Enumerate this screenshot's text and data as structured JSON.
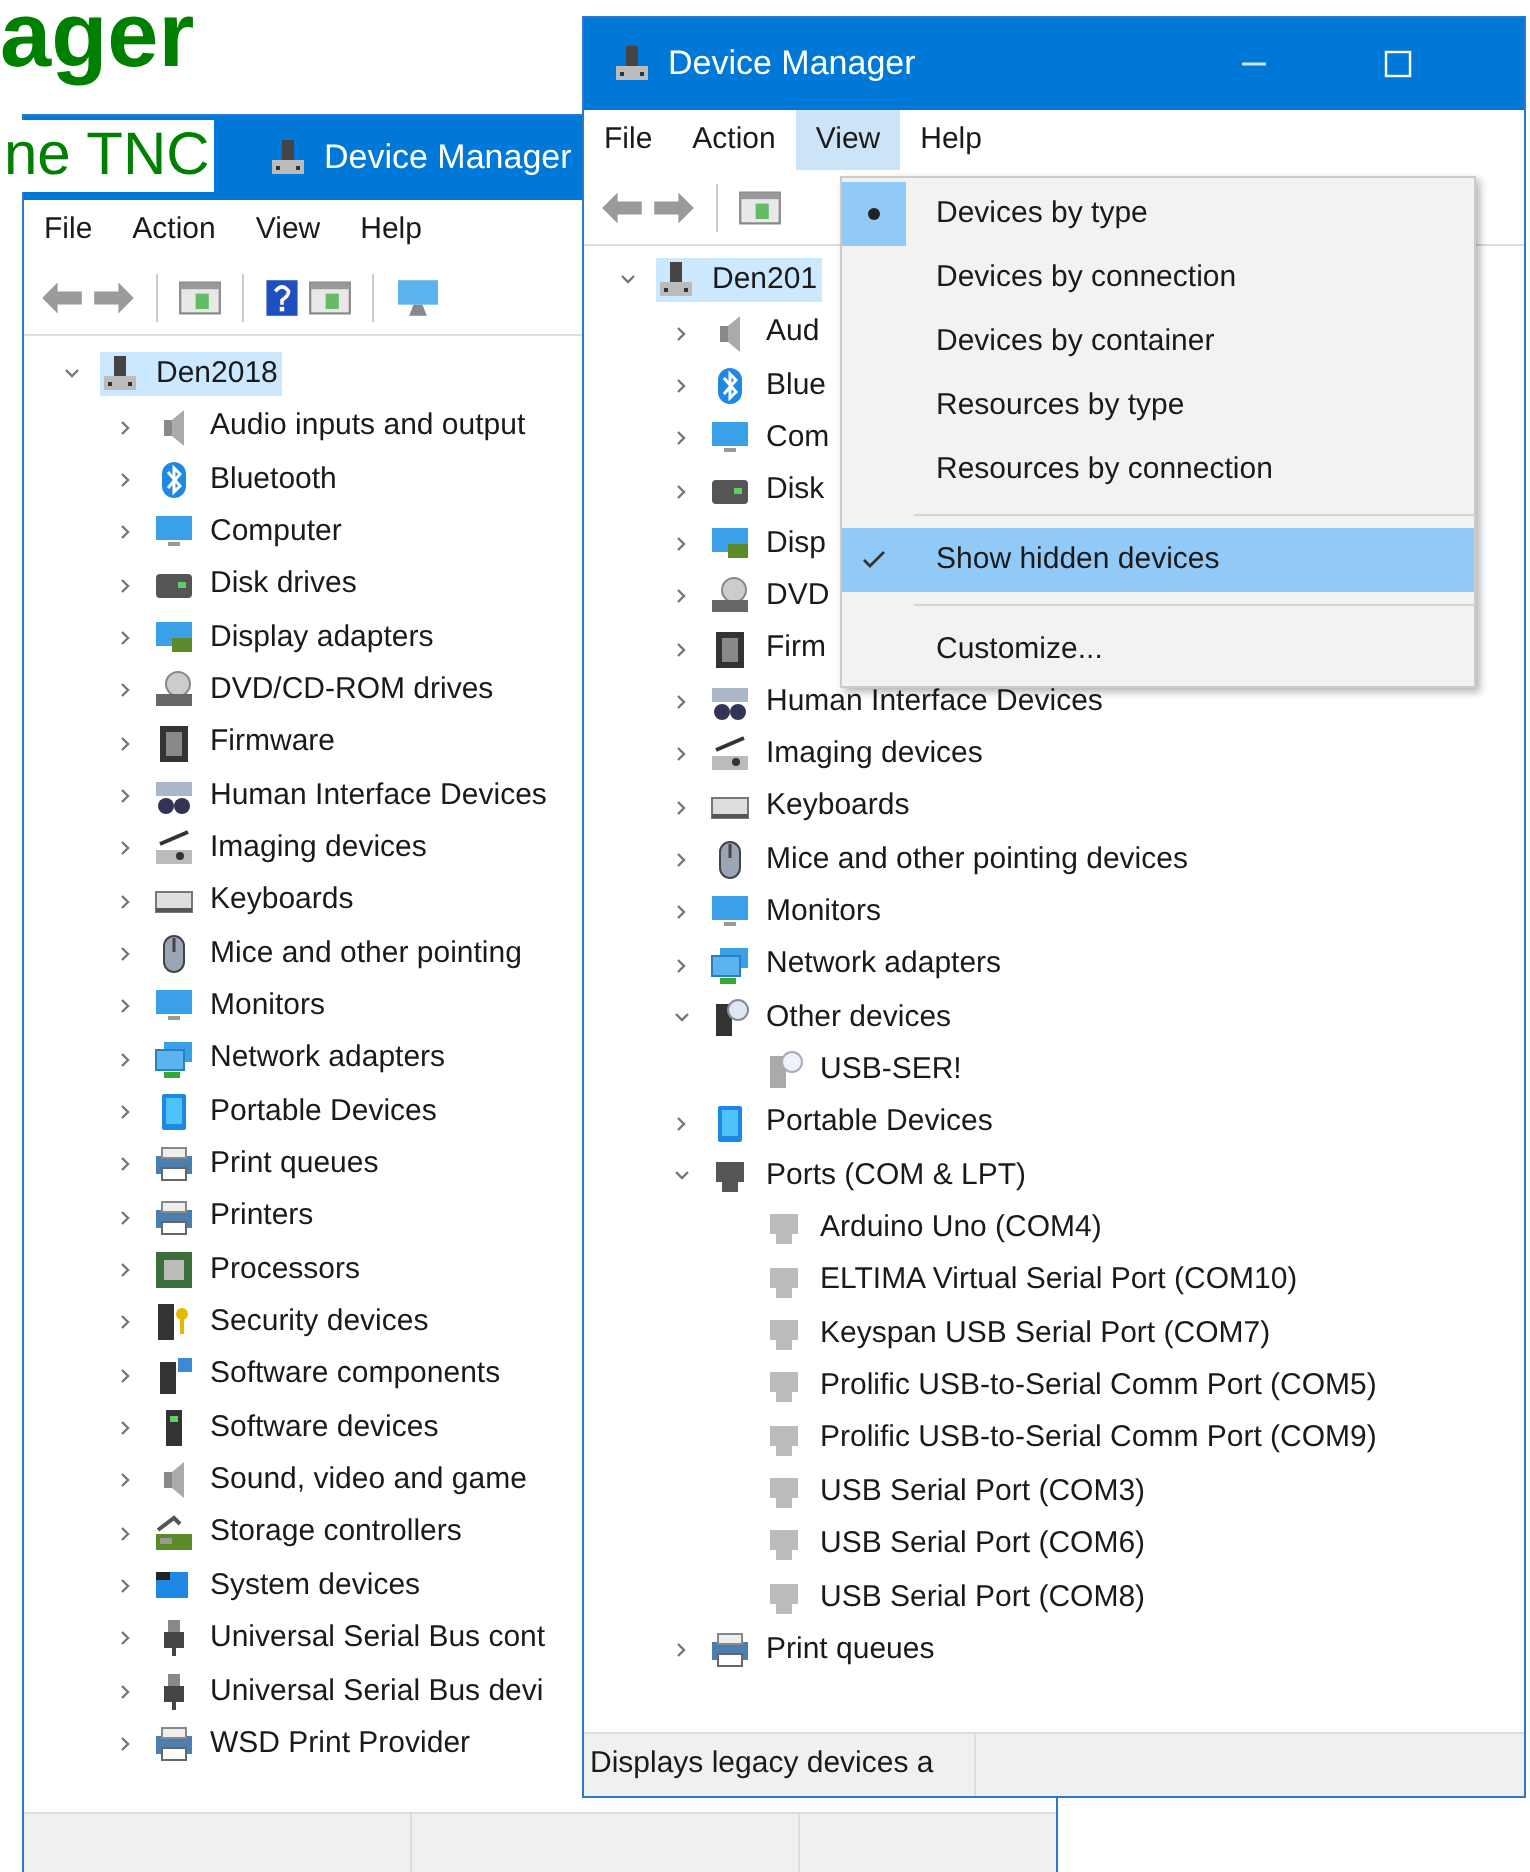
{
  "slide": {
    "heading": "ager",
    "subheading": "ne TNC"
  },
  "back_window": {
    "title": "Device Manager",
    "menu": [
      {
        "label": "File",
        "selected": false
      },
      {
        "label": "Action",
        "selected": false
      },
      {
        "label": "View",
        "selected": false
      },
      {
        "label": "Help",
        "selected": false
      }
    ],
    "tree": {
      "label": "Den2018",
      "kind": "root",
      "expanded": true,
      "selected": true,
      "children": [
        {
          "label": "Audio inputs and output",
          "kind": "audio",
          "expanded": false,
          "selected": false
        },
        {
          "label": "Bluetooth",
          "kind": "bluetooth",
          "expanded": false,
          "selected": false
        },
        {
          "label": "Computer",
          "kind": "monitor",
          "expanded": false,
          "selected": false
        },
        {
          "label": "Disk drives",
          "kind": "disk",
          "expanded": false,
          "selected": false
        },
        {
          "label": "Display adapters",
          "kind": "display",
          "expanded": false,
          "selected": false
        },
        {
          "label": "DVD/CD-ROM drives",
          "kind": "dvd",
          "expanded": false,
          "selected": false
        },
        {
          "label": "Firmware",
          "kind": "firmware",
          "expanded": false,
          "selected": false
        },
        {
          "label": "Human Interface Devices",
          "kind": "hid",
          "expanded": false,
          "selected": false
        },
        {
          "label": "Imaging devices",
          "kind": "imaging",
          "expanded": false,
          "selected": false
        },
        {
          "label": "Keyboards",
          "kind": "keyboard",
          "expanded": false,
          "selected": false
        },
        {
          "label": "Mice and other pointing",
          "kind": "mouse",
          "expanded": false,
          "selected": false
        },
        {
          "label": "Monitors",
          "kind": "monitor",
          "expanded": false,
          "selected": false
        },
        {
          "label": "Network adapters",
          "kind": "network",
          "expanded": false,
          "selected": false
        },
        {
          "label": "Portable Devices",
          "kind": "portable",
          "expanded": false,
          "selected": false
        },
        {
          "label": "Print queues",
          "kind": "printer",
          "expanded": false,
          "selected": false
        },
        {
          "label": "Printers",
          "kind": "printer",
          "expanded": false,
          "selected": false
        },
        {
          "label": "Processors",
          "kind": "processor",
          "expanded": false,
          "selected": false
        },
        {
          "label": "Security devices",
          "kind": "security",
          "expanded": false,
          "selected": false
        },
        {
          "label": "Software components",
          "kind": "component",
          "expanded": false,
          "selected": false
        },
        {
          "label": "Software devices",
          "kind": "tower",
          "expanded": false,
          "selected": false
        },
        {
          "label": "Sound, video and game",
          "kind": "audio",
          "expanded": false,
          "selected": false
        },
        {
          "label": "Storage controllers",
          "kind": "storage",
          "expanded": false,
          "selected": false
        },
        {
          "label": "System devices",
          "kind": "system",
          "expanded": false,
          "selected": false
        },
        {
          "label": "Universal Serial Bus cont",
          "kind": "usb",
          "expanded": false,
          "selected": false
        },
        {
          "label": "Universal Serial Bus devi",
          "kind": "usb",
          "expanded": false,
          "selected": false
        },
        {
          "label": "WSD Print Provider",
          "kind": "printer",
          "expanded": false,
          "selected": false
        }
      ]
    }
  },
  "front_window": {
    "title": "Device Manager",
    "menu": [
      {
        "label": "File",
        "selected": false
      },
      {
        "label": "Action",
        "selected": false
      },
      {
        "label": "View",
        "selected": true
      },
      {
        "label": "Help",
        "selected": false
      }
    ],
    "tree": {
      "label": "Den201",
      "kind": "root",
      "expanded": true,
      "selected": true,
      "children": [
        {
          "label": "Aud",
          "kind": "audio",
          "expanded": false,
          "selected": false
        },
        {
          "label": "Blue",
          "kind": "bluetooth",
          "expanded": false,
          "selected": false
        },
        {
          "label": "Com",
          "kind": "monitor",
          "expanded": false,
          "selected": false
        },
        {
          "label": "Disk",
          "kind": "disk",
          "expanded": false,
          "selected": false
        },
        {
          "label": "Disp",
          "kind": "display",
          "expanded": false,
          "selected": false
        },
        {
          "label": "DVD",
          "kind": "dvd",
          "expanded": false,
          "selected": false
        },
        {
          "label": "Firm",
          "kind": "firmware",
          "expanded": false,
          "selected": false
        },
        {
          "label": "Human Interface Devices",
          "kind": "hid",
          "expanded": false,
          "selected": false
        },
        {
          "label": "Imaging devices",
          "kind": "imaging",
          "expanded": false,
          "selected": false
        },
        {
          "label": "Keyboards",
          "kind": "keyboard",
          "expanded": false,
          "selected": false
        },
        {
          "label": "Mice and other pointing devices",
          "kind": "mouse",
          "expanded": false,
          "selected": false
        },
        {
          "label": "Monitors",
          "kind": "monitor",
          "expanded": false,
          "selected": false
        },
        {
          "label": "Network adapters",
          "kind": "network",
          "expanded": false,
          "selected": false
        },
        {
          "label": "Other devices",
          "kind": "other",
          "expanded": true,
          "selected": false,
          "children": [
            {
              "label": "USB-SER!",
              "kind": "unknown",
              "selected": false
            }
          ]
        },
        {
          "label": "Portable Devices",
          "kind": "portable",
          "expanded": false,
          "selected": false
        },
        {
          "label": "Ports (COM & LPT)",
          "kind": "port",
          "expanded": true,
          "selected": false,
          "children": [
            {
              "label": "Arduino Uno (COM4)",
              "kind": "portitem",
              "selected": false
            },
            {
              "label": "ELTIMA Virtual Serial Port (COM10)",
              "kind": "portitem",
              "selected": false
            },
            {
              "label": "Keyspan USB Serial Port (COM7)",
              "kind": "portitem",
              "selected": false
            },
            {
              "label": "Prolific USB-to-Serial Comm Port (COM5)",
              "kind": "portitem",
              "selected": false
            },
            {
              "label": "Prolific USB-to-Serial Comm Port (COM9)",
              "kind": "portitem",
              "selected": false
            },
            {
              "label": "USB Serial Port (COM3)",
              "kind": "portitem",
              "selected": false
            },
            {
              "label": "USB Serial Port (COM6)",
              "kind": "portitem",
              "selected": false
            },
            {
              "label": "USB Serial Port (COM8)",
              "kind": "portitem",
              "selected": false
            }
          ]
        },
        {
          "label": "Print queues",
          "kind": "printer",
          "expanded": false,
          "selected": false
        }
      ]
    },
    "status_bar": "Displays legacy devices a"
  },
  "view_menu": {
    "items": [
      {
        "kind": "radio",
        "label": "Devices by type",
        "checked": true,
        "highlighted": false
      },
      {
        "kind": "radio",
        "label": "Devices by connection",
        "checked": false,
        "highlighted": false
      },
      {
        "kind": "radio",
        "label": "Devices by container",
        "checked": false,
        "highlighted": false
      },
      {
        "kind": "radio",
        "label": "Resources by type",
        "checked": false,
        "highlighted": false
      },
      {
        "kind": "radio",
        "label": "Resources by connection",
        "checked": false,
        "highlighted": false
      },
      {
        "kind": "separator"
      },
      {
        "kind": "check",
        "label": "Show hidden devices",
        "checked": true,
        "highlighted": true
      },
      {
        "kind": "separator"
      },
      {
        "kind": "command",
        "label": "Customize..."
      }
    ]
  }
}
